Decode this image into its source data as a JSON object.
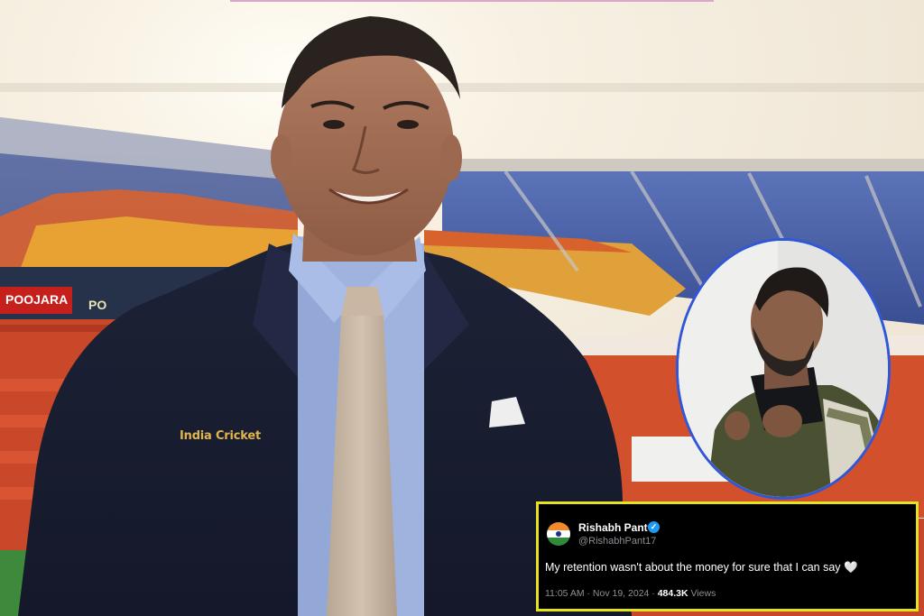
{
  "image": {
    "description_elements": [
      "stadium-background",
      "man-in-suit",
      "circular-inset-portrait",
      "tweet-card"
    ]
  },
  "jacket_badge": {
    "text": "India Cricket"
  },
  "stadium_boards": {
    "left_board": "POOJARA",
    "left_board_2": "PO"
  },
  "tweet": {
    "name": "Rishabh Pant",
    "handle": "@RishabhPant17",
    "text": "My retention wasn't about the money for sure that  I can say",
    "heart": "🤍",
    "time": "11:05 AM · Nov 19, 2024 · ",
    "views_count": "484.3K",
    "views_label": " Views"
  },
  "colors": {
    "tweet_border": "#e6e21e",
    "inset_border": "#2f57d8",
    "verified": "#1d9bf0"
  }
}
